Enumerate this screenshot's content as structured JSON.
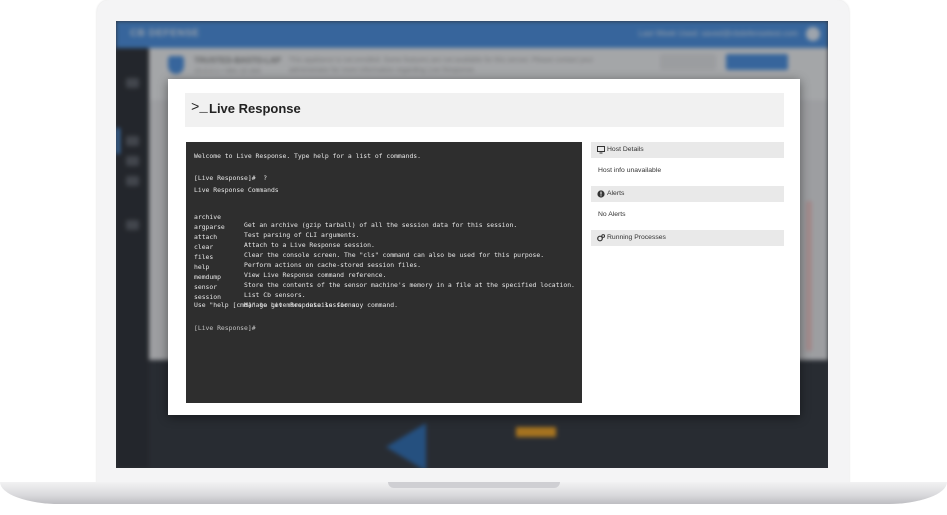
{
  "background_app": {
    "brand": "CB DEFENSE",
    "user": "Last Week Used: saved@cbdefensetest.com",
    "device_title": "TRUSTED-BASTO-LAP",
    "device_subtitle": "10.0.0.1 • Win 10 x64",
    "notice": "This appliance is not enrolled. Some features are not available for this sensor. Please contact your administrator for more information regarding Live Response."
  },
  "modal": {
    "prompt_glyph": ">_",
    "title": "Live Response"
  },
  "console": {
    "welcome": "Welcome to Live Response. Type help for a list of commands.",
    "prompt_with_help": "[Live Response]#  ?",
    "commands_heading": "Live Response Commands",
    "commands": [
      {
        "name": "archive",
        "desc": "Get an archive (gzip tarball) of all the session data for this session."
      },
      {
        "name": "argparse",
        "desc": "Test parsing of CLI arguments."
      },
      {
        "name": "attach",
        "desc": "Attach to a Live Response session."
      },
      {
        "name": "clear",
        "desc": "Clear the console screen. The \"cls\" command can also be used for this purpose."
      },
      {
        "name": "files",
        "desc": "Perform actions on cache-stored session files."
      },
      {
        "name": "help",
        "desc": "View Live Response command reference."
      },
      {
        "name": "memdump",
        "desc": "Store the contents of the sensor machine's memory in a file at the specified location."
      },
      {
        "name": "sensor",
        "desc": "List Cb sensors."
      },
      {
        "name": "session",
        "desc": "Manage Live Response sessions."
      }
    ],
    "usage_hint": "Use \"help [cmd]\" to get more details for any command.",
    "current_prompt": "[Live Response]#"
  },
  "side_panel": {
    "host_details": {
      "label": "Host Details",
      "icon": "monitor-icon",
      "body": "Host info unavailable"
    },
    "alerts": {
      "label": "Alerts",
      "icon": "exclamation-circle-icon",
      "body": "No Alerts"
    },
    "running_processes": {
      "label": "Running Processes",
      "icon": "gears-icon"
    }
  },
  "colors": {
    "accent": "#4a90e2",
    "console_bg": "#2e2e2e",
    "panel_header_bg": "#e9e9e9"
  }
}
